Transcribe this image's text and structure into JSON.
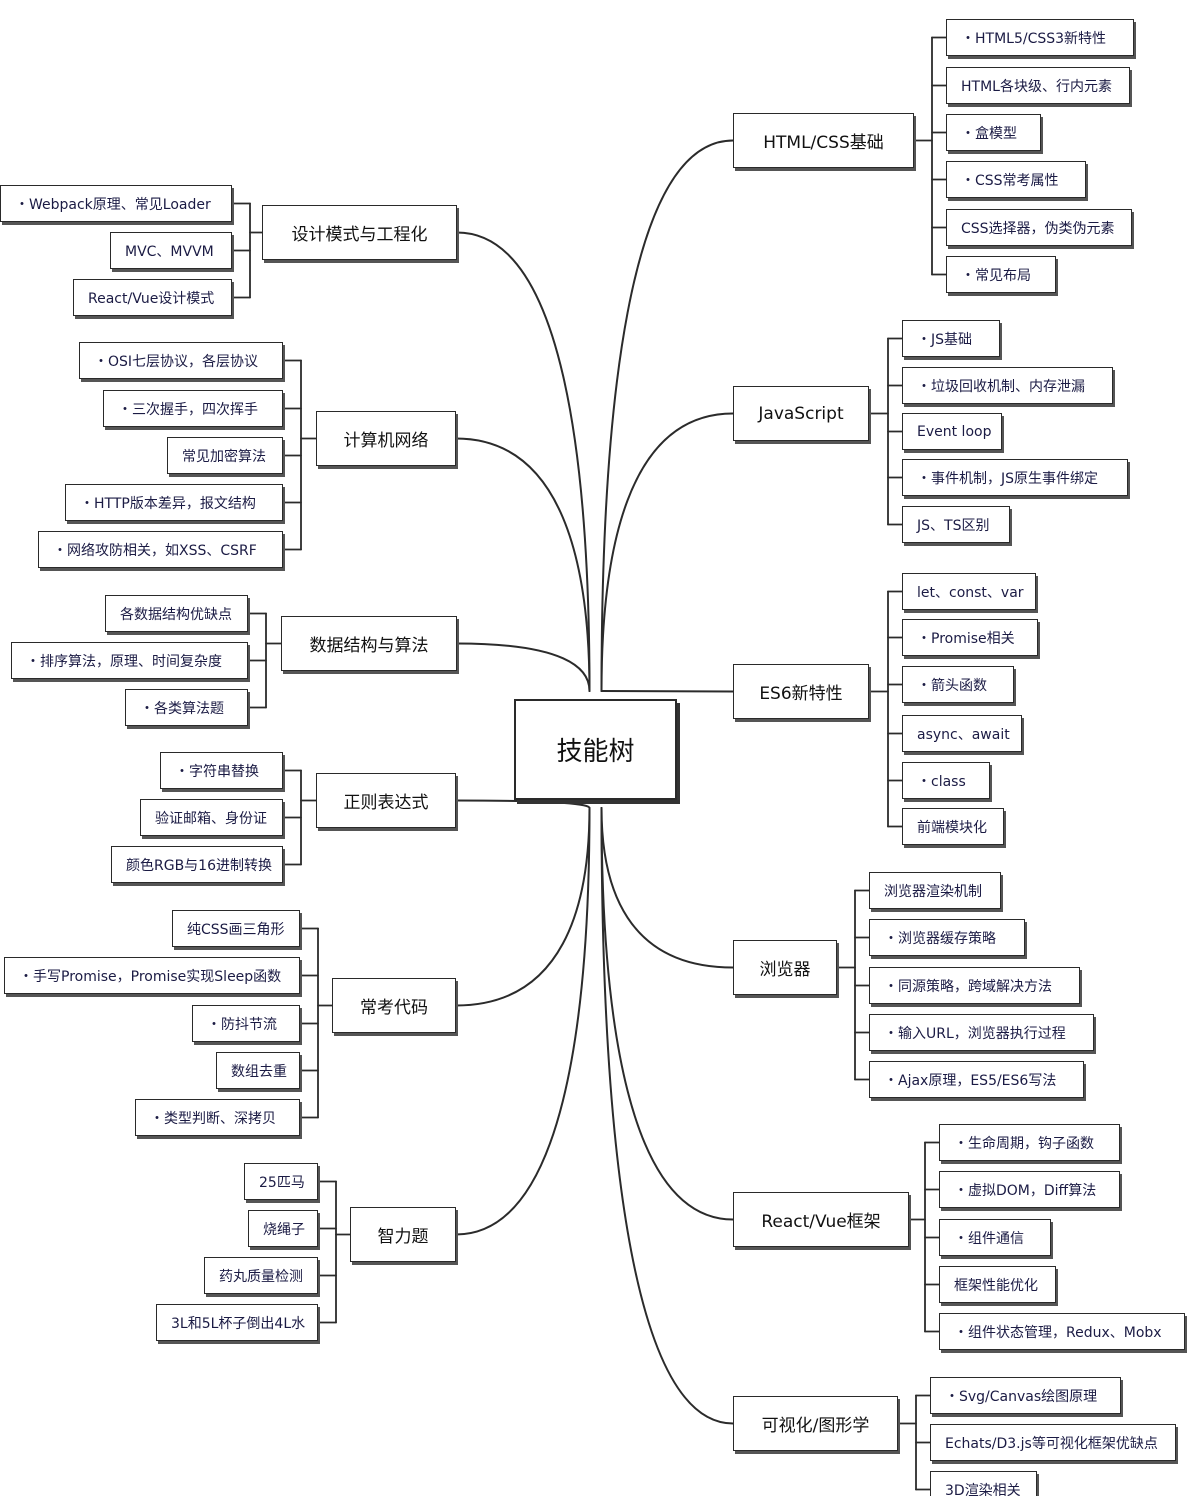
{
  "root": "技能树",
  "branches": [
    {
      "id": "html",
      "label": "HTML/CSS基础",
      "items": [
        "・HTML5/CSS3新特性",
        "HTML各块级、行内元素",
        "・盒模型",
        "・CSS常考属性",
        "CSS选择器，伪类伪元素",
        "・常见布局"
      ]
    },
    {
      "id": "js",
      "label": "JavaScript",
      "items": [
        "・JS基础",
        "・垃圾回收机制、内存泄漏",
        "Event loop",
        "・事件机制，JS原生事件绑定",
        "JS、TS区别"
      ]
    },
    {
      "id": "es6",
      "label": "ES6新特性",
      "items": [
        "let、const、var",
        "・Promise相关",
        "・箭头函数",
        "async、await",
        "・class",
        "前端模块化"
      ]
    },
    {
      "id": "browser",
      "label": "浏览器",
      "items": [
        "浏览器渲染机制",
        "・浏览器缓存策略",
        "・同源策略，跨域解决方法",
        "・输入URL，浏览器执行过程",
        "・Ajax原理，ES5/ES6写法"
      ]
    },
    {
      "id": "framework",
      "label": "React/Vue框架",
      "items": [
        "・生命周期，钩子函数",
        "・虚拟DOM，Diff算法",
        "・组件通信",
        "框架性能优化",
        "・组件状态管理，Redux、Mobx"
      ]
    },
    {
      "id": "vis",
      "label": "可视化/图形学",
      "items": [
        "・Svg/Canvas绘图原理",
        "Echats/D3.js等可视化框架优缺点",
        "3D渲染相关"
      ]
    },
    {
      "id": "design",
      "label": "设计模式与工程化",
      "items": [
        "・Webpack原理、常见Loader",
        "MVC、MVVM",
        "React/Vue设计模式"
      ]
    },
    {
      "id": "network",
      "label": "计算机网络",
      "items": [
        "・OSI七层协议，各层协议",
        "・三次握手，四次挥手",
        "常见加密算法",
        "・HTTP版本差异，报文结构",
        "・网络攻防相关，如XSS、CSRF"
      ]
    },
    {
      "id": "algo",
      "label": "数据结构与算法",
      "items": [
        "各数据结构优缺点",
        "・排序算法，原理、时间复杂度",
        "・各类算法题"
      ]
    },
    {
      "id": "regex",
      "label": "正则表达式",
      "items": [
        "・字符串替换",
        "验证邮箱、身份证",
        "颜色RGB与16进制转换"
      ]
    },
    {
      "id": "code",
      "label": "常考代码",
      "items": [
        "纯CSS画三角形",
        "・手写Promise，Promise实现Sleep函数",
        "・防抖节流",
        "数组去重",
        "・类型判断、深拷贝"
      ]
    },
    {
      "id": "puzzle",
      "label": "智力题",
      "items": [
        "25匹马",
        "烧绳子",
        "药丸质量检测",
        "3L和5L杯子倒出4L水"
      ]
    }
  ]
}
